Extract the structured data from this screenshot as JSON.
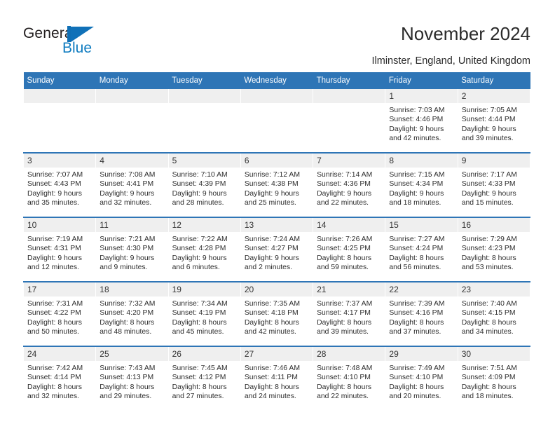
{
  "brand": {
    "name_line1": "General",
    "name_line2": "Blue",
    "mark": "triangle-logo",
    "color_dark": "#231f20",
    "color_blue": "#0f7cc0"
  },
  "header": {
    "title": "November 2024",
    "subtitle": "Ilminster, England, United Kingdom",
    "accent_color": "#2e75b6",
    "daynum_band_color": "#efefef"
  },
  "calendar": {
    "weekday_headers": [
      "Sunday",
      "Monday",
      "Tuesday",
      "Wednesday",
      "Thursday",
      "Friday",
      "Saturday"
    ],
    "weeks": [
      [
        {
          "day": "",
          "lines": []
        },
        {
          "day": "",
          "lines": []
        },
        {
          "day": "",
          "lines": []
        },
        {
          "day": "",
          "lines": []
        },
        {
          "day": "",
          "lines": []
        },
        {
          "day": "1",
          "lines": [
            "Sunrise: 7:03 AM",
            "Sunset: 4:46 PM",
            "Daylight: 9 hours",
            "and 42 minutes."
          ]
        },
        {
          "day": "2",
          "lines": [
            "Sunrise: 7:05 AM",
            "Sunset: 4:44 PM",
            "Daylight: 9 hours",
            "and 39 minutes."
          ]
        }
      ],
      [
        {
          "day": "3",
          "lines": [
            "Sunrise: 7:07 AM",
            "Sunset: 4:43 PM",
            "Daylight: 9 hours",
            "and 35 minutes."
          ]
        },
        {
          "day": "4",
          "lines": [
            "Sunrise: 7:08 AM",
            "Sunset: 4:41 PM",
            "Daylight: 9 hours",
            "and 32 minutes."
          ]
        },
        {
          "day": "5",
          "lines": [
            "Sunrise: 7:10 AM",
            "Sunset: 4:39 PM",
            "Daylight: 9 hours",
            "and 28 minutes."
          ]
        },
        {
          "day": "6",
          "lines": [
            "Sunrise: 7:12 AM",
            "Sunset: 4:38 PM",
            "Daylight: 9 hours",
            "and 25 minutes."
          ]
        },
        {
          "day": "7",
          "lines": [
            "Sunrise: 7:14 AM",
            "Sunset: 4:36 PM",
            "Daylight: 9 hours",
            "and 22 minutes."
          ]
        },
        {
          "day": "8",
          "lines": [
            "Sunrise: 7:15 AM",
            "Sunset: 4:34 PM",
            "Daylight: 9 hours",
            "and 18 minutes."
          ]
        },
        {
          "day": "9",
          "lines": [
            "Sunrise: 7:17 AM",
            "Sunset: 4:33 PM",
            "Daylight: 9 hours",
            "and 15 minutes."
          ]
        }
      ],
      [
        {
          "day": "10",
          "lines": [
            "Sunrise: 7:19 AM",
            "Sunset: 4:31 PM",
            "Daylight: 9 hours",
            "and 12 minutes."
          ]
        },
        {
          "day": "11",
          "lines": [
            "Sunrise: 7:21 AM",
            "Sunset: 4:30 PM",
            "Daylight: 9 hours",
            "and 9 minutes."
          ]
        },
        {
          "day": "12",
          "lines": [
            "Sunrise: 7:22 AM",
            "Sunset: 4:28 PM",
            "Daylight: 9 hours",
            "and 6 minutes."
          ]
        },
        {
          "day": "13",
          "lines": [
            "Sunrise: 7:24 AM",
            "Sunset: 4:27 PM",
            "Daylight: 9 hours",
            "and 2 minutes."
          ]
        },
        {
          "day": "14",
          "lines": [
            "Sunrise: 7:26 AM",
            "Sunset: 4:25 PM",
            "Daylight: 8 hours",
            "and 59 minutes."
          ]
        },
        {
          "day": "15",
          "lines": [
            "Sunrise: 7:27 AM",
            "Sunset: 4:24 PM",
            "Daylight: 8 hours",
            "and 56 minutes."
          ]
        },
        {
          "day": "16",
          "lines": [
            "Sunrise: 7:29 AM",
            "Sunset: 4:23 PM",
            "Daylight: 8 hours",
            "and 53 minutes."
          ]
        }
      ],
      [
        {
          "day": "17",
          "lines": [
            "Sunrise: 7:31 AM",
            "Sunset: 4:22 PM",
            "Daylight: 8 hours",
            "and 50 minutes."
          ]
        },
        {
          "day": "18",
          "lines": [
            "Sunrise: 7:32 AM",
            "Sunset: 4:20 PM",
            "Daylight: 8 hours",
            "and 48 minutes."
          ]
        },
        {
          "day": "19",
          "lines": [
            "Sunrise: 7:34 AM",
            "Sunset: 4:19 PM",
            "Daylight: 8 hours",
            "and 45 minutes."
          ]
        },
        {
          "day": "20",
          "lines": [
            "Sunrise: 7:35 AM",
            "Sunset: 4:18 PM",
            "Daylight: 8 hours",
            "and 42 minutes."
          ]
        },
        {
          "day": "21",
          "lines": [
            "Sunrise: 7:37 AM",
            "Sunset: 4:17 PM",
            "Daylight: 8 hours",
            "and 39 minutes."
          ]
        },
        {
          "day": "22",
          "lines": [
            "Sunrise: 7:39 AM",
            "Sunset: 4:16 PM",
            "Daylight: 8 hours",
            "and 37 minutes."
          ]
        },
        {
          "day": "23",
          "lines": [
            "Sunrise: 7:40 AM",
            "Sunset: 4:15 PM",
            "Daylight: 8 hours",
            "and 34 minutes."
          ]
        }
      ],
      [
        {
          "day": "24",
          "lines": [
            "Sunrise: 7:42 AM",
            "Sunset: 4:14 PM",
            "Daylight: 8 hours",
            "and 32 minutes."
          ]
        },
        {
          "day": "25",
          "lines": [
            "Sunrise: 7:43 AM",
            "Sunset: 4:13 PM",
            "Daylight: 8 hours",
            "and 29 minutes."
          ]
        },
        {
          "day": "26",
          "lines": [
            "Sunrise: 7:45 AM",
            "Sunset: 4:12 PM",
            "Daylight: 8 hours",
            "and 27 minutes."
          ]
        },
        {
          "day": "27",
          "lines": [
            "Sunrise: 7:46 AM",
            "Sunset: 4:11 PM",
            "Daylight: 8 hours",
            "and 24 minutes."
          ]
        },
        {
          "day": "28",
          "lines": [
            "Sunrise: 7:48 AM",
            "Sunset: 4:10 PM",
            "Daylight: 8 hours",
            "and 22 minutes."
          ]
        },
        {
          "day": "29",
          "lines": [
            "Sunrise: 7:49 AM",
            "Sunset: 4:10 PM",
            "Daylight: 8 hours",
            "and 20 minutes."
          ]
        },
        {
          "day": "30",
          "lines": [
            "Sunrise: 7:51 AM",
            "Sunset: 4:09 PM",
            "Daylight: 8 hours",
            "and 18 minutes."
          ]
        }
      ]
    ]
  }
}
